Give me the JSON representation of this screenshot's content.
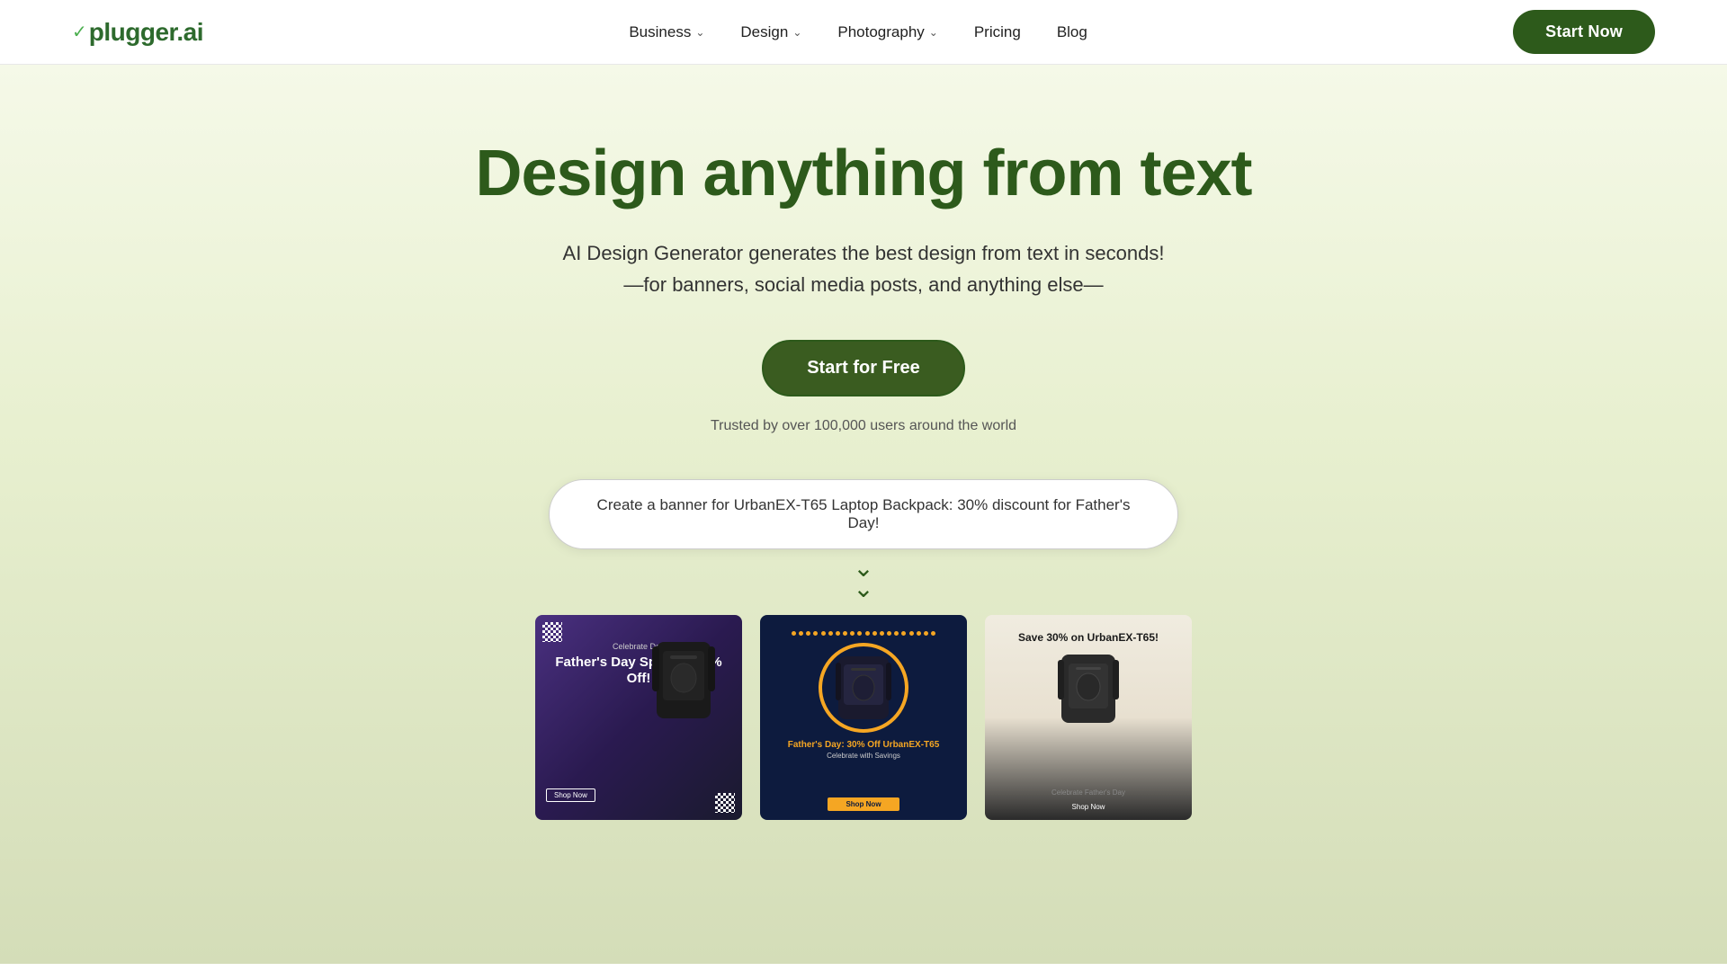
{
  "navbar": {
    "logo": "plugger.ai",
    "logo_icon": "✓",
    "nav_items": [
      {
        "label": "Business",
        "has_dropdown": true
      },
      {
        "label": "Design",
        "has_dropdown": true
      },
      {
        "label": "Photography",
        "has_dropdown": true
      },
      {
        "label": "Pricing",
        "has_dropdown": false
      },
      {
        "label": "Blog",
        "has_dropdown": false
      }
    ],
    "cta_label": "Start Now"
  },
  "hero": {
    "title": "Design anything from text",
    "subtitle_line1": "AI Design Generator generates the best design from text in seconds!",
    "subtitle_line2": "—for banners, social media posts, and anything else—",
    "cta_label": "Start for Free",
    "trust_text": "Trusted by over 100,000 users around the world",
    "prompt_text": "Create a banner for UrbanEX-T65 Laptop Backpack: 30% discount for Father's Day!"
  },
  "cards": [
    {
      "id": "card1",
      "bg": "purple",
      "celebrate_label": "Celebrate Dad",
      "title": "Father's Day Special: 30% Off!",
      "cta": "Shop Now"
    },
    {
      "id": "card2",
      "bg": "navy",
      "title": "Father's Day: 30% Off UrbanEX-T65",
      "subtitle": "Celebrate with Savings",
      "cta": "Shop Now"
    },
    {
      "id": "card3",
      "bg": "light",
      "title": "Save 30% on UrbanEX-T65!",
      "celebrate_label": "Celebrate Father's Day",
      "cta": "Shop Now"
    }
  ]
}
